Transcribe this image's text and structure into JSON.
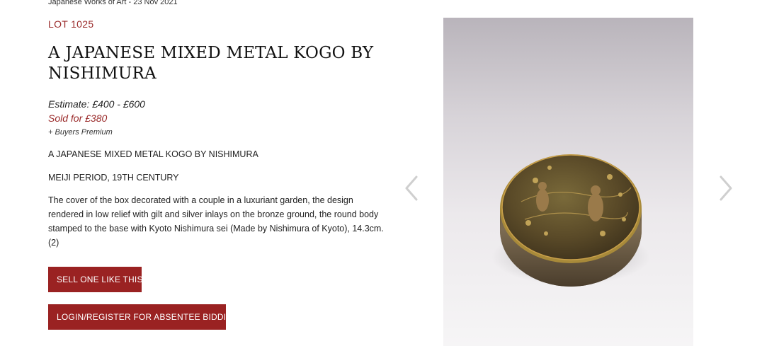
{
  "breadcrumb": "Japanese Works of Art - 23 Nov 2021",
  "lot": {
    "label": "LOT 1025",
    "title": "A JAPANESE MIXED METAL KOGO BY NISHIMURA",
    "estimate": "Estimate: £400 - £600",
    "sold": "Sold for £380",
    "premium": "+ Buyers Premium"
  },
  "description": {
    "heading": "A JAPANESE MIXED METAL KOGO BY NISHIMURA",
    "period": "MEIJI PERIOD, 19TH CENTURY",
    "body": "The cover of the box decorated with a couple in a luxuriant garden, the design rendered in low relief with gilt and silver inlays on the bronze ground, the round body stamped to the base with Kyoto Nishimura sei (Made by Nishimura of Kyoto), 14.3cm. (2)"
  },
  "actions": {
    "sell_label": "SELL ONE LIKE THIS",
    "login_label": "LOGIN/REGISTER FOR ABSENTEE BIDDING"
  },
  "gallery": {
    "prev_icon": "chevron-left-icon",
    "next_icon": "chevron-right-icon"
  },
  "colors": {
    "accent": "#9a2222",
    "lot_text": "#9a2a2a"
  }
}
